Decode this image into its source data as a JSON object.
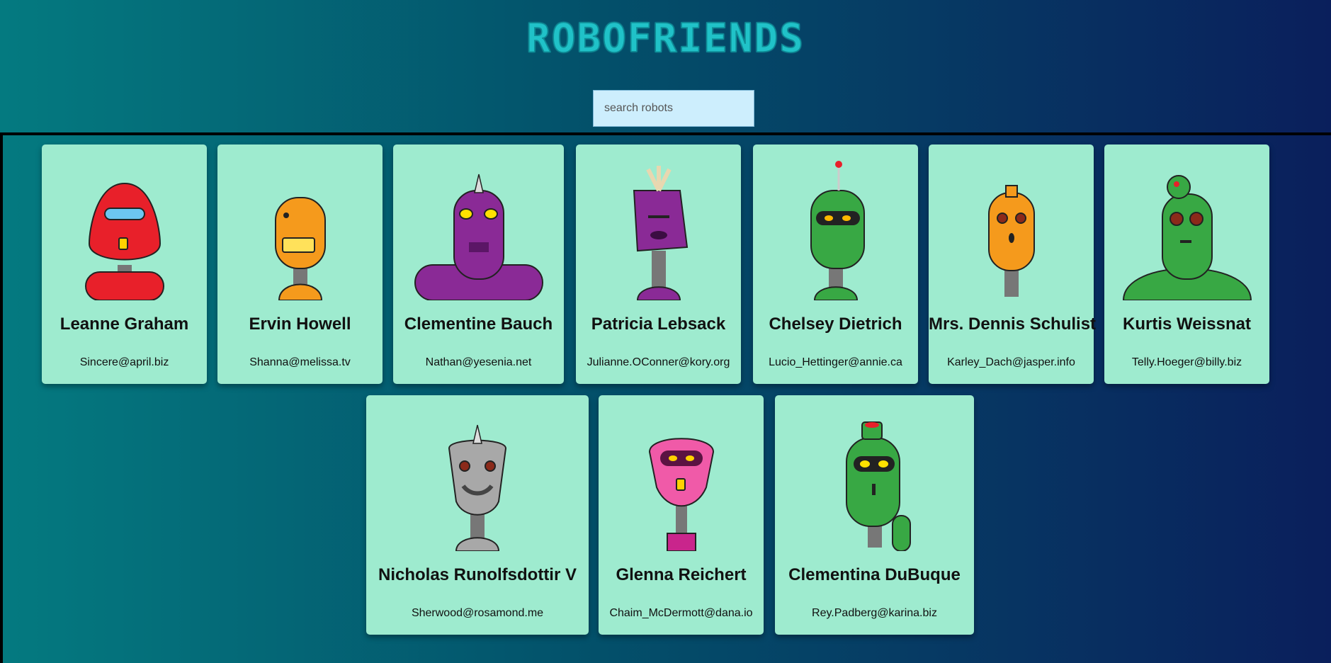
{
  "header": {
    "logo": "ROBOFRIENDS",
    "search_placeholder": "search robots"
  },
  "robots": [
    {
      "name": "Leanne Graham",
      "email": "Sincere@april.biz",
      "color": "#e8202a",
      "accent": "#6cc6f0"
    },
    {
      "name": "Ervin Howell",
      "email": "Shanna@melissa.tv",
      "color": "#f59a1c",
      "accent": "#ffe15a"
    },
    {
      "name": "Clementine Bauch",
      "email": "Nathan@yesenia.net",
      "color": "#8a2a96",
      "accent": "#ffe100"
    },
    {
      "name": "Patricia Lebsack",
      "email": "Julianne.OConner@kory.org",
      "color": "#8a2a96",
      "accent": "#e8d7b0"
    },
    {
      "name": "Chelsey Dietrich",
      "email": "Lucio_Hettinger@annie.ca",
      "color": "#38a844",
      "accent": "#ffb800"
    },
    {
      "name": "Mrs. Dennis Schulist",
      "email": "Karley_Dach@jasper.info",
      "color": "#f59a1c",
      "accent": "#8b2a1a"
    },
    {
      "name": "Kurtis Weissnat",
      "email": "Telly.Hoeger@billy.biz",
      "color": "#38a844",
      "accent": "#8b2a1a"
    },
    {
      "name": "Nicholas Runolfsdottir V",
      "email": "Sherwood@rosamond.me",
      "color": "#a8a8a8",
      "accent": "#8b2a1a"
    },
    {
      "name": "Glenna Reichert",
      "email": "Chaim_McDermott@dana.io",
      "color": "#f05aa8",
      "accent": "#ffd200"
    },
    {
      "name": "Clementina DuBuque",
      "email": "Rey.Padberg@karina.biz",
      "color": "#38a844",
      "accent": "#ffe100"
    }
  ]
}
